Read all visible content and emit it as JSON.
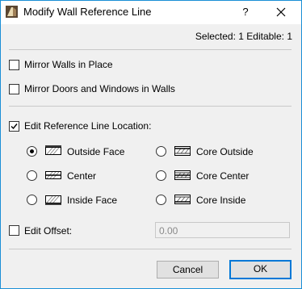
{
  "window": {
    "title": "Modify Wall Reference Line",
    "help_label": "?",
    "border_color": "#1a8fd6"
  },
  "status": {
    "text": "Selected: 1 Editable: 1"
  },
  "options": {
    "mirror_walls": {
      "label": "Mirror Walls in Place",
      "checked": false
    },
    "mirror_doors": {
      "label": "Mirror Doors and Windows in Walls",
      "checked": false
    },
    "edit_ref_line": {
      "label": "Edit Reference Line Location:",
      "checked": true
    }
  },
  "reference_locations": {
    "selected": "Outside Face",
    "items": [
      {
        "label": "Outside Face",
        "icon": "wall-outside-face-icon"
      },
      {
        "label": "Center",
        "icon": "wall-center-icon"
      },
      {
        "label": "Inside Face",
        "icon": "wall-inside-face-icon"
      },
      {
        "label": "Core Outside",
        "icon": "wall-core-outside-icon"
      },
      {
        "label": "Core Center",
        "icon": "wall-core-center-icon"
      },
      {
        "label": "Core Inside",
        "icon": "wall-core-inside-icon"
      }
    ]
  },
  "offset": {
    "label": "Edit Offset:",
    "checked": false,
    "value": "0.00"
  },
  "buttons": {
    "cancel": "Cancel",
    "ok": "OK"
  },
  "colors": {
    "accent": "#0078d7",
    "dialog_bg": "#f0f0f0"
  }
}
